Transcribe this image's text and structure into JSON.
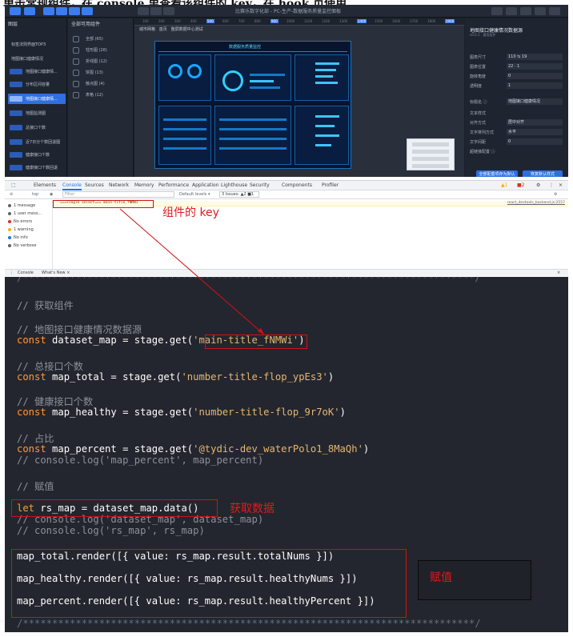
{
  "caption": "单击常规组件，在 console 里查看该组件的 key，在 hook 页使用",
  "editor": {
    "title": "比赛乐数字化部 - PC-生产-数据服务质量监控面板",
    "layers_header": "图层",
    "layers": [
      "标签法则界面TOP3",
      "地图接口健康情况",
      "地图接口健康情...",
      "分布区间容量",
      "地图接口健康情...",
      "地图监测图",
      "总接口个数",
      "近7日分个数回退图",
      "健康接口个数",
      "健康接口个数回退"
    ],
    "components_header": "全部可用组件",
    "components": [
      "全部 (65)",
      "柱形图 (26)",
      "折线图 (12)",
      "饼图 (13)",
      "散点图 (4)",
      "表格 (12)"
    ],
    "canvas_tab": "城市网格",
    "canvas_tab2": "首页",
    "canvas_tab3": "整屏数据中心测试",
    "ruler_ticks": [
      "100",
      "200",
      "300",
      "400",
      "500",
      "600",
      "700",
      "800",
      "900",
      "1000",
      "1100",
      "1200",
      "1300",
      "1400",
      "1500",
      "1600",
      "1700",
      "1800",
      "1900",
      "2000"
    ],
    "dash_title": "数据服务质量监控",
    "props_title": "地图接口健康情况数据源",
    "props_sub": "v0.0.1 · 通用组件",
    "props": [
      {
        "label": "图表尺寸",
        "value": "110 ⇆ 19"
      },
      {
        "label": "图表位置",
        "value": "22  ·  1"
      },
      {
        "label": "旋转角度",
        "value": "0"
      },
      {
        "label": "透明度",
        "value": "1"
      },
      {
        "label": "标题名 ⓘ",
        "value": "地图接口健康情况"
      },
      {
        "label": "文本样式",
        "value": ""
      },
      {
        "label": "对齐方式",
        "value": "居中对齐"
      },
      {
        "label": "文字排列方式",
        "value": "水平"
      },
      {
        "label": "文字间距",
        "value": "0"
      },
      {
        "label": "超链接配置 ⓘ",
        "value": ""
      }
    ],
    "btn_save": "全部配置项存为默认",
    "btn_reset": "恢复默认样式",
    "zoom": "36%"
  },
  "devtools": {
    "tabs": [
      "Elements",
      "Console",
      "Sources",
      "Network",
      "Memory",
      "Performance",
      "Application",
      "Lighthouse",
      "Security",
      "Components",
      "Profiler"
    ],
    "context": "top",
    "filter_placeholder": "Filter",
    "levels": "Default levels ▾",
    "issues": "3 Issues: ▲2 ■1",
    "warn_count": "▲1",
    "err_count": "■2",
    "sidebar": [
      {
        "label": "1 message",
        "color": "#5f6368"
      },
      {
        "label": "1 user mess...",
        "color": "#5f6368"
      },
      {
        "label": "No errors",
        "color": "#d93025"
      },
      {
        "label": "1 warning",
        "color": "#f9ab00"
      },
      {
        "label": "No info",
        "color": "#1a73e8"
      },
      {
        "label": "No verbose",
        "color": "#5f6368"
      }
    ],
    "log_message": "===single select=== main-title_fNMWi",
    "log_source": "react_devtools_backend.js:2557",
    "drawer_tabs": [
      "Console",
      "What's New ×"
    ]
  },
  "annotations": {
    "key_label": "组件的 key",
    "fetch_label": "获取数据",
    "assign_label": "赋值"
  },
  "code": {
    "deco_top": "/*****************************************************************************/",
    "c1": "// 获取组件",
    "c2": "// 地图接口健康情况数据源",
    "l2a": "const",
    "l2b": " dataset_map = stage.get(",
    "l2s": "'main-title_fNMWi'",
    "l2c": ")",
    "c3": "// 总接口个数",
    "l3a": "const",
    "l3b": " map_total = stage.get(",
    "l3s": "'number-title-flop_ypEs3'",
    "l3c": ")",
    "c4": "// 健康接口个数",
    "l4a": "const",
    "l4b": " map_healthy = stage.get(",
    "l4s": "'number-title-flop_9r7oK'",
    "l4c": ")",
    "c5": "// 占比",
    "l5a": "const",
    "l5b": " map_percent = stage.get(",
    "l5s": "'@tydic-dev_waterPolo1_8MaQh'",
    "l5c": ")",
    "c6": "// console.log('map_percent', map_percent)",
    "c7": "// 赋值",
    "l7a": "let",
    "l7b": " rs_map = dataset_map.data()",
    "c8": "// console.log('dataset_map', dataset_map)",
    "c9": "// console.log('rs_map', rs_map)",
    "r1": "map_total.render([{ value: rs_map.result.totalNums }])",
    "r2": "map_healthy.render([{ value: rs_map.result.healthyNums }])",
    "r3": "map_percent.render([{ value: rs_map.result.healthyPercent }])",
    "deco_bottom": "/*****************************************************************************/"
  }
}
